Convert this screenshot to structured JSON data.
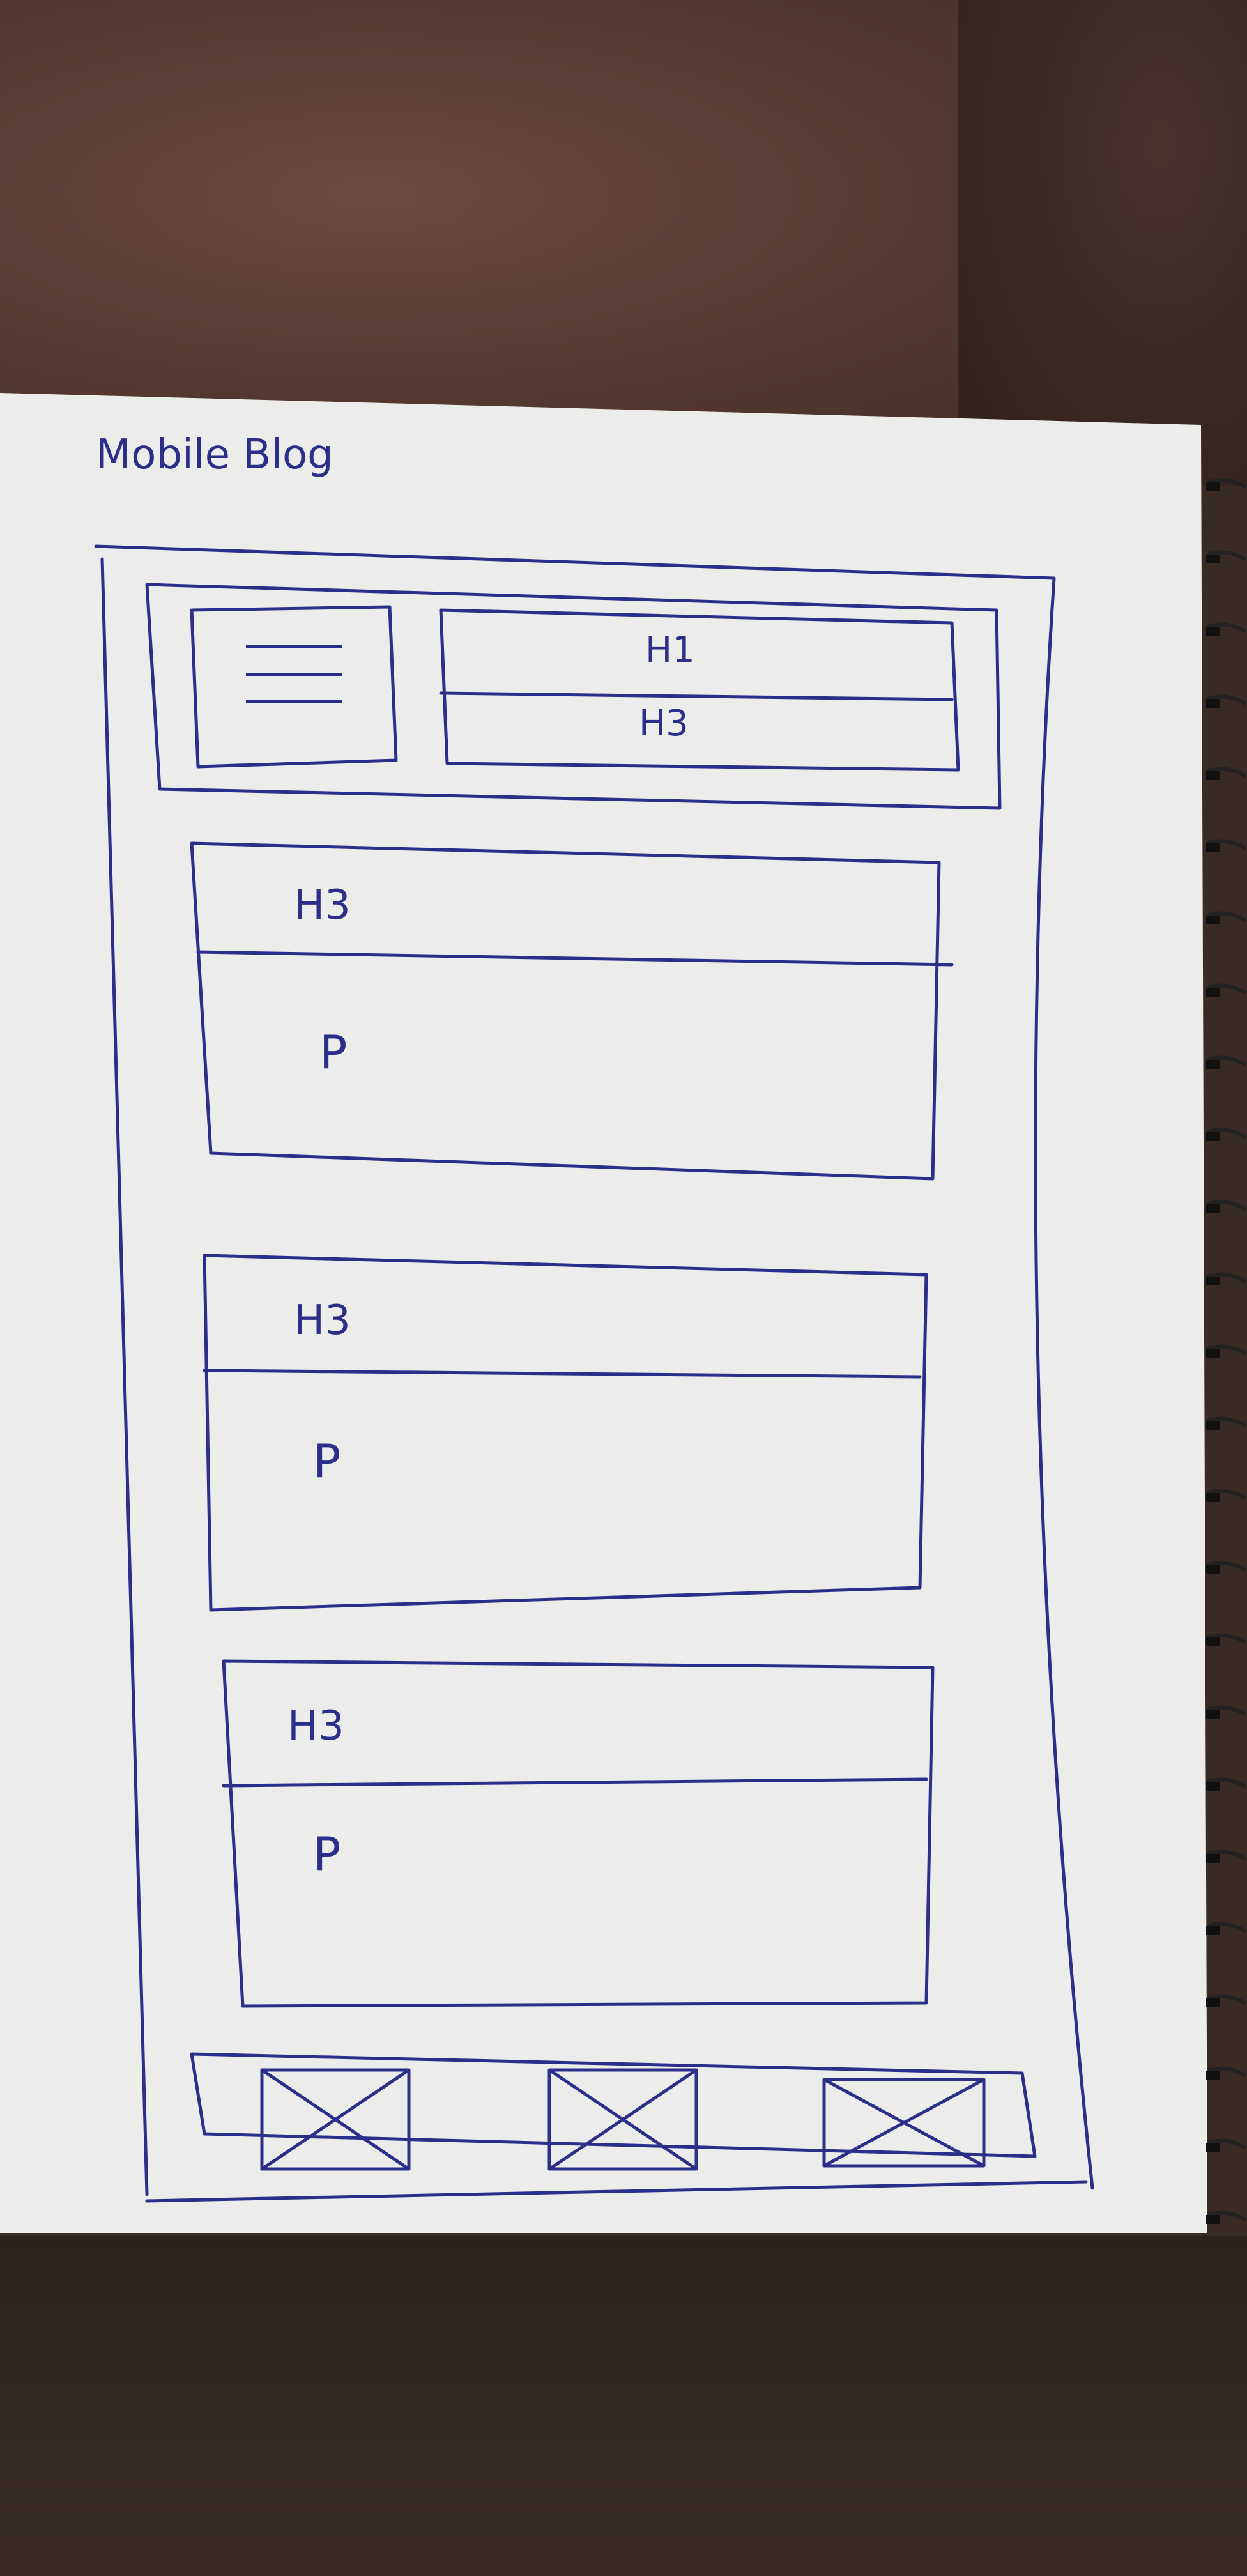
{
  "sketch_title": "Mobile Blog",
  "header": {
    "h1_label": "H1",
    "h3_label": "H3"
  },
  "posts": [
    {
      "heading": "H3",
      "body": "P"
    },
    {
      "heading": "H3",
      "body": "P"
    },
    {
      "heading": "H3",
      "body": "P"
    }
  ],
  "footer": {
    "image_placeholders": 3
  },
  "colors": {
    "ink": "#2c2f8a",
    "paper": "#ececea",
    "background": "#3a2a25"
  }
}
